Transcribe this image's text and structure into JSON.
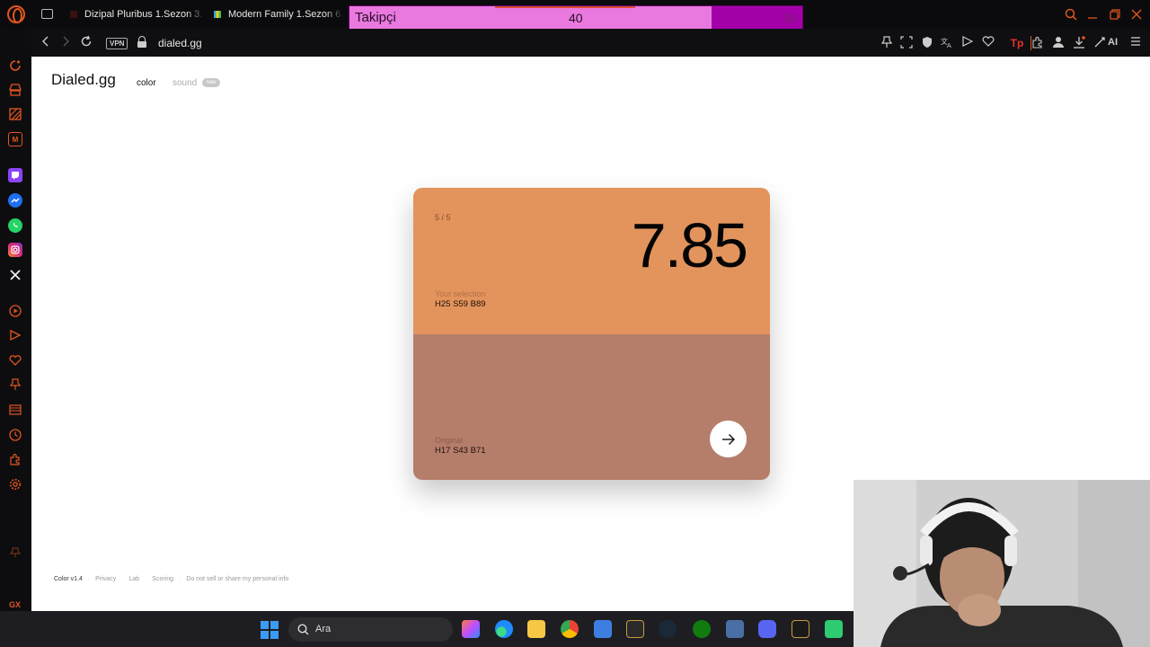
{
  "browser": {
    "tabs": [
      {
        "title": "Dizipal Pluribus 1.Sezon 3."
      },
      {
        "title": "Modern Family 1.Sezon 6."
      }
    ],
    "follower_widget": {
      "label": "Takipçi",
      "current": 40,
      "goal": 50,
      "progress_fraction": 0.8
    },
    "address": {
      "vpn_label": "VPN",
      "url": "dialed.gg"
    },
    "ai_label": "AI"
  },
  "page": {
    "logo": "Dialed.gg",
    "nav": {
      "color": "color",
      "sound": "sound",
      "new_badge": "new"
    },
    "card": {
      "round": "5 / 5",
      "score": "7.85",
      "selection_label": "Your selection",
      "selection_value": "H25 S59 B89",
      "selection_color": "#E3945D",
      "original_label": "Original",
      "original_value": "H17 S43 B71",
      "original_color": "#B57E6A"
    },
    "footer": {
      "version": "Color v1.4",
      "links": [
        "Privacy",
        "Lab",
        "Scoring",
        "Do not sell or share my personal info"
      ]
    }
  },
  "sidebar": {
    "gx_label": "GX",
    "more": "..."
  },
  "taskbar": {
    "search_placeholder": "Ara"
  },
  "colors": {
    "accent": "#e2551f",
    "follower_fill": "#e979df",
    "follower_bg": "#a400a9"
  }
}
